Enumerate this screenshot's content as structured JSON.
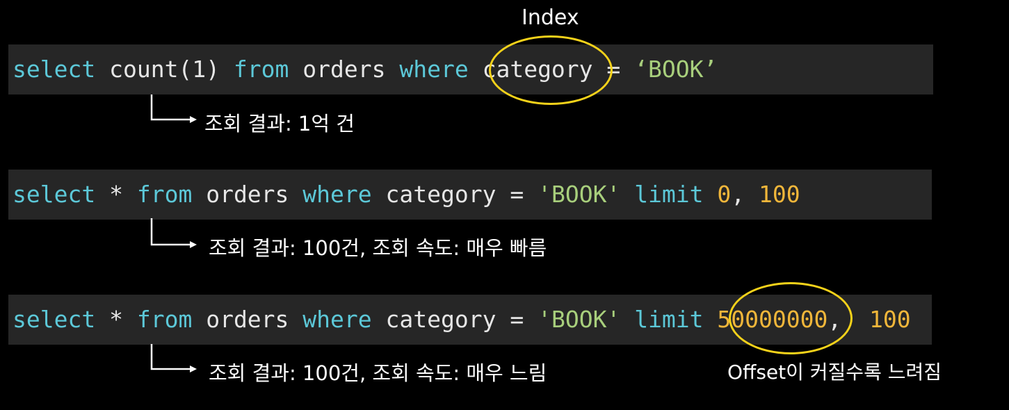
{
  "line1": {
    "kw_select": "select",
    "text_count": "count(1)",
    "kw_from": "from",
    "text_orders": "orders",
    "kw_where": "where",
    "text_category": "category",
    "text_eq": "=",
    "str_book": "‘BOOK’"
  },
  "line2": {
    "kw_select": "select",
    "text_star": "*",
    "kw_from": "from",
    "text_orders": "orders",
    "kw_where": "where",
    "text_category": "category",
    "text_eq": "=",
    "str_book": "'BOOK'",
    "kw_limit": "limit",
    "num_offset": "0",
    "text_comma": ",",
    "num_count": "100"
  },
  "line3": {
    "kw_select": "select",
    "text_star": "*",
    "kw_from": "from",
    "text_orders": "orders",
    "kw_where": "where",
    "text_category": "category",
    "text_eq": "=",
    "str_book": "'BOOK'",
    "kw_limit": "limit",
    "num_offset": "50000000",
    "text_comma": ",",
    "num_count": "100"
  },
  "annotations": {
    "index_label": "Index",
    "result1": "조회 결과: 1억 건",
    "result2": "조회 결과: 100건, 조회 속도: 매우 빠름",
    "result3": "조회 결과: 100건, 조회 속도: 매우 느림",
    "offset_note": "Offset이 커질수록 느려짐"
  },
  "colors": {
    "background": "#000000",
    "code_bar": "#262626",
    "keyword": "#5cc8d8",
    "string": "#a8cf7c",
    "number": "#f0b63a",
    "highlight_ellipse": "#f5d21a"
  }
}
